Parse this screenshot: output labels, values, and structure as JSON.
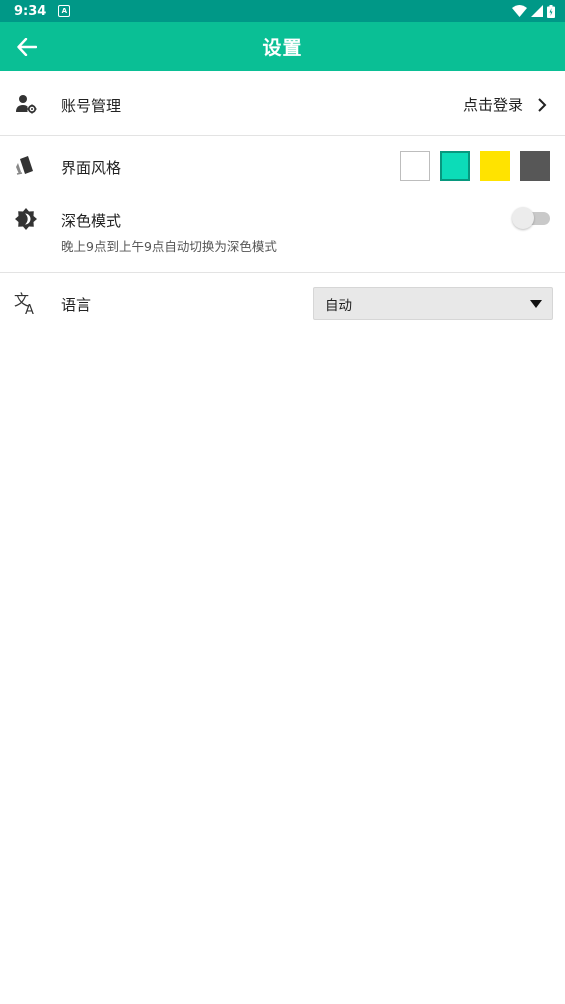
{
  "status_bar": {
    "time": "9:34",
    "notification_icon": "a-box-icon",
    "wifi_icon": "wifi-icon",
    "signal_icon": "signal-icon",
    "battery_icon": "battery-icon"
  },
  "app_bar": {
    "title": "设置",
    "back_icon": "arrow-left-icon",
    "color": "#0abf95"
  },
  "settings": {
    "account": {
      "label": "账号管理",
      "action": "点击登录",
      "icon": "user-gear-icon"
    },
    "theme": {
      "label": "界面风格",
      "icon": "palette-icon",
      "swatches": [
        {
          "name": "white",
          "color": "#ffffff"
        },
        {
          "name": "teal",
          "color": "#0cdcb8"
        },
        {
          "name": "yellow",
          "color": "#ffe300"
        },
        {
          "name": "dark-gray",
          "color": "#575757"
        }
      ],
      "selected": "teal"
    },
    "dark_mode": {
      "label": "深色模式",
      "description": "晚上9点到上午9点自动切换为深色模式",
      "enabled": false,
      "icon": "brightness-icon"
    },
    "language": {
      "label": "语言",
      "value": "自动",
      "icon": "translate-icon"
    }
  }
}
